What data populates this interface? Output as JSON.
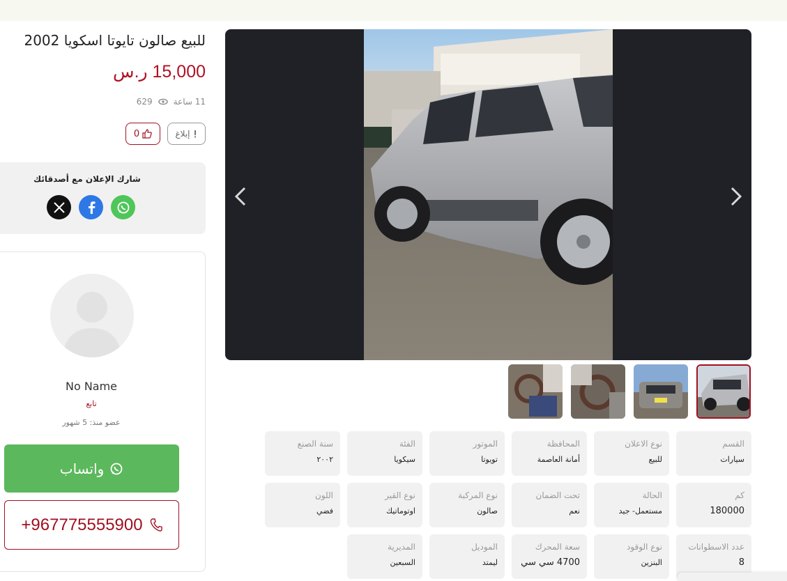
{
  "listing": {
    "title": "للبيع صالون تايوتا اسكويا 2002",
    "price": "15,000 ر.س",
    "time_ago": "11 ساعة",
    "views": "629",
    "report_label": "إبلاغ",
    "likes": "0"
  },
  "share": {
    "title": "شارك الإعلان مع أصدقائك",
    "icons": [
      "whatsapp-icon",
      "facebook-icon",
      "x-icon"
    ],
    "colors": {
      "whatsapp": "#4fc65a",
      "facebook": "#2e78e6",
      "x": "#111111"
    }
  },
  "seller": {
    "name": "No Name",
    "role": "تابع",
    "member_since": "عضو منذ: 5 شهور",
    "whatsapp_label": "واتساب",
    "phone": "+967775555900"
  },
  "specs": [
    {
      "label": "القسم",
      "value": "سيارات"
    },
    {
      "label": "نوع الاعلان",
      "value": "للبيع"
    },
    {
      "label": "المحافظة",
      "value": "أمانة العاصمة"
    },
    {
      "label": "الموتور",
      "value": "تويوتا"
    },
    {
      "label": "الفئة",
      "value": "سيكويا"
    },
    {
      "label": "سنة الصنع",
      "value": "٢٠٠٢"
    },
    {
      "label": "كم",
      "value": "180000"
    },
    {
      "label": "الحالة",
      "value": "مستعمل- جيد"
    },
    {
      "label": "تحت الضمان",
      "value": "نعم"
    },
    {
      "label": "نوع المركبة",
      "value": "صالون"
    },
    {
      "label": "نوع القير",
      "value": "اوتوماتيك"
    },
    {
      "label": "اللون",
      "value": "فضي"
    },
    {
      "label": "عدد الاسطوانات",
      "value": "8"
    },
    {
      "label": "نوع الوقود",
      "value": "البنزين"
    },
    {
      "label": "سعة المحرك",
      "value": "4700 سي سي"
    },
    {
      "label": "الموديل",
      "value": "ليمتد"
    },
    {
      "label": "المديرية",
      "value": "السبعين"
    }
  ],
  "colors": {
    "accent": "#b01123",
    "whatsapp_button": "#5cb85c",
    "gallery_bg": "#1f2126",
    "spec_bg": "#f1f1f1"
  }
}
